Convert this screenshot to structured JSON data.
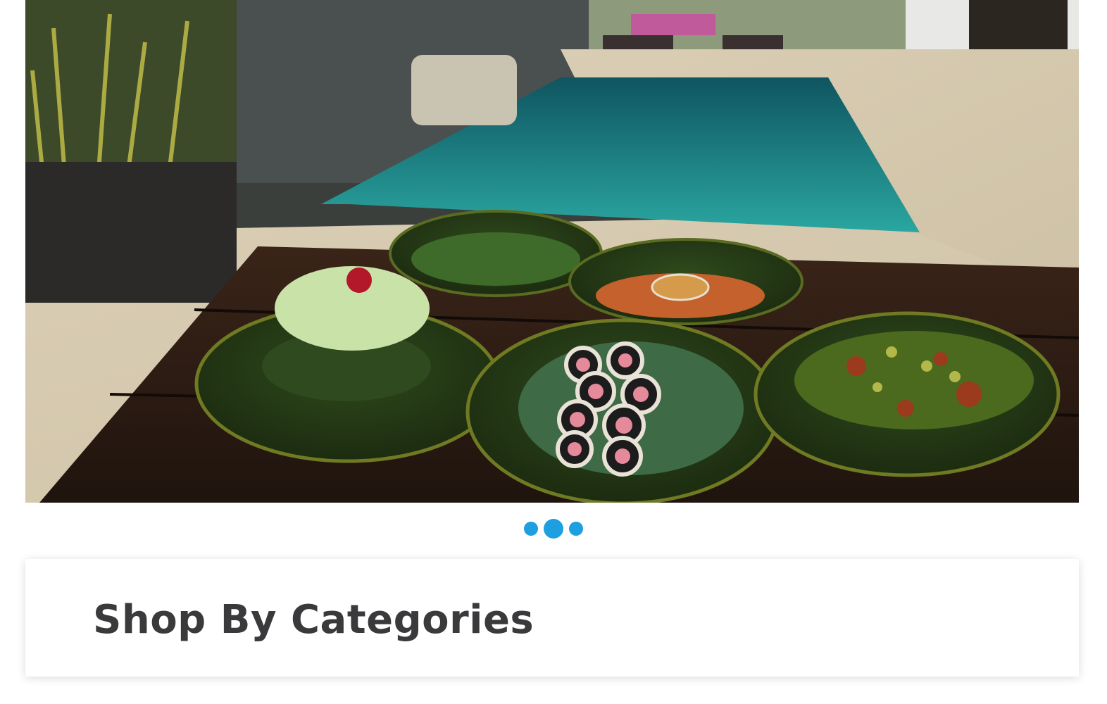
{
  "hero": {
    "image_alt": "Poolside table with bowls of salad, burger, sushi and dipping sauce",
    "icon": "hero-food-photo"
  },
  "slider": {
    "slide_count": 3,
    "active_index": 1,
    "accent_color": "#1e9fe0"
  },
  "categories": {
    "title": "Shop By Categories"
  }
}
